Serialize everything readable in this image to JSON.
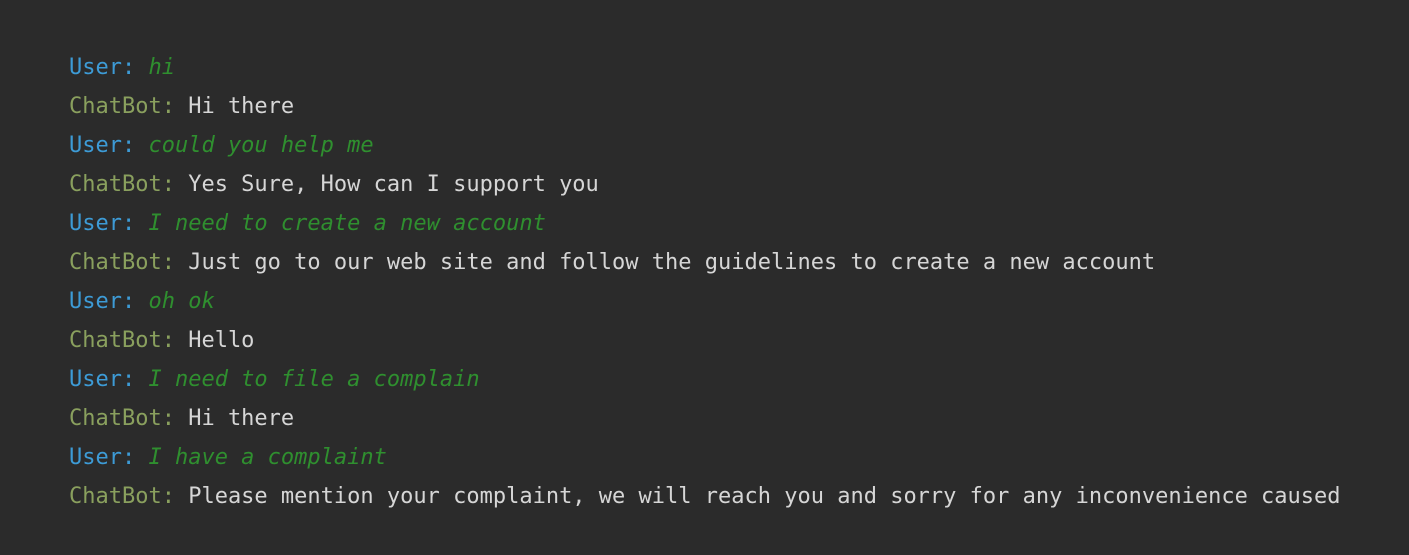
{
  "console": {
    "lines": [
      {
        "speaker": "User:",
        "text": "hi"
      },
      {
        "speaker": "ChatBot:",
        "text": "Hi there"
      },
      {
        "speaker": "User:",
        "text": "could you help me"
      },
      {
        "speaker": "ChatBot:",
        "text": "Yes Sure, How can I support you"
      },
      {
        "speaker": "User:",
        "text": "I need to create a new account"
      },
      {
        "speaker": "ChatBot:",
        "text": "Just go to our web site and follow the guidelines to create a new account"
      },
      {
        "speaker": "User:",
        "text": "oh ok"
      },
      {
        "speaker": "ChatBot:",
        "text": "Hello"
      },
      {
        "speaker": "User:",
        "text": "I need to file a complain"
      },
      {
        "speaker": "ChatBot:",
        "text": "Hi there"
      },
      {
        "speaker": "User:",
        "text": "I have a complaint"
      },
      {
        "speaker": "ChatBot:",
        "text": "Please mention your complaint, we will reach you and sorry for any inconvenience caused"
      }
    ]
  },
  "colors": {
    "background": "#2b2b2b",
    "user_label": "#3d9bd6",
    "bot_label": "#8aa05e",
    "user_text": "#2f8f2f",
    "bot_text": "#d6d6d6"
  }
}
